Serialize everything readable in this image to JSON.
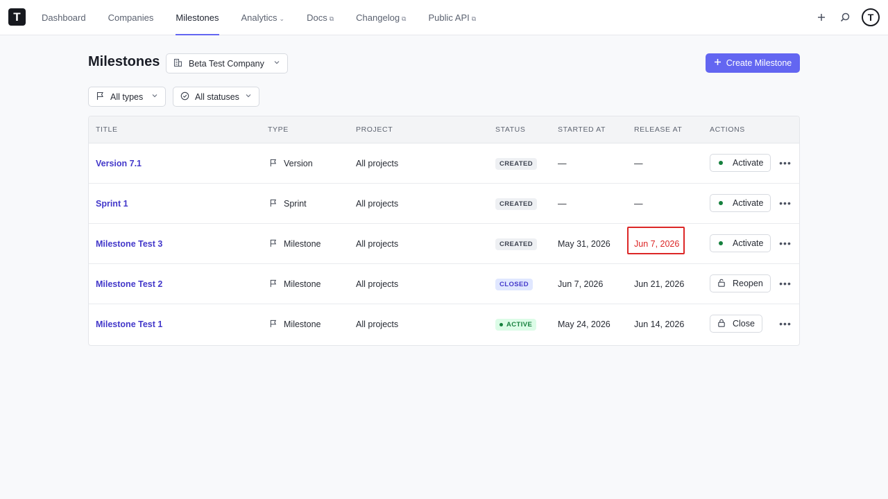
{
  "app": {
    "logo_letter": "T",
    "avatar_letter": "T"
  },
  "nav": [
    {
      "label": "Dashboard",
      "suffix": ""
    },
    {
      "label": "Companies",
      "suffix": ""
    },
    {
      "label": "Milestones",
      "suffix": ""
    },
    {
      "label": "Analytics",
      "suffix": "⌄"
    },
    {
      "label": "Docs",
      "suffix": "⧉"
    },
    {
      "label": "Changelog",
      "suffix": "⧉"
    },
    {
      "label": "Public API",
      "suffix": "⧉"
    }
  ],
  "active_nav": "Milestones",
  "header": {
    "title": "Milestones",
    "company_select": "Beta Test Company",
    "create_button": "Create Milestone"
  },
  "filters": {
    "types": "All types",
    "statuses": "All statuses"
  },
  "table": {
    "columns": [
      "TITLE",
      "TYPE",
      "PROJECT",
      "STATUS",
      "STARTED AT",
      "RELEASE AT",
      "ACTIONS"
    ],
    "rows": [
      {
        "title": "Version 7.1",
        "type": "Version",
        "project": "All projects",
        "status": "CREATED",
        "started": "—",
        "release": "—",
        "action": "Activate"
      },
      {
        "title": "Sprint 1",
        "type": "Sprint",
        "project": "All projects",
        "status": "CREATED",
        "started": "—",
        "release": "—",
        "action": "Activate"
      },
      {
        "title": "Milestone Test 3",
        "type": "Milestone",
        "project": "All projects",
        "status": "CREATED",
        "started": "May 31, 2026",
        "release": "Jun 7, 2026",
        "action": "Activate"
      },
      {
        "title": "Milestone Test 2",
        "type": "Milestone",
        "project": "All projects",
        "status": "CLOSED",
        "started": "Jun 7, 2026",
        "release": "Jun 21, 2026",
        "action": "Reopen"
      },
      {
        "title": "Milestone Test 1",
        "type": "Milestone",
        "project": "All projects",
        "status": "ACTIVE",
        "started": "May 24, 2026",
        "release": "Jun 14, 2026",
        "action": "Close"
      }
    ]
  },
  "colors": {
    "accent": "#6366f1",
    "link": "#4338ca",
    "overdue": "#dc2626",
    "active": "#15803d"
  }
}
